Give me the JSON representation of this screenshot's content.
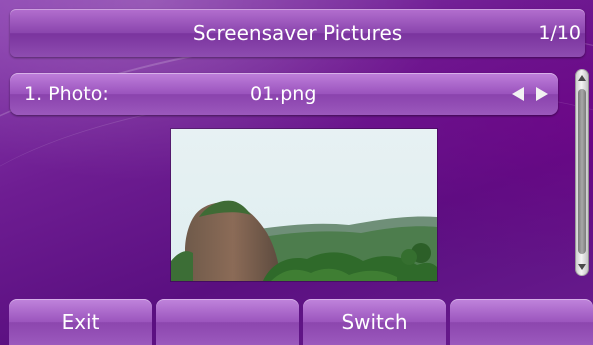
{
  "title_bar": {
    "title": "Screensaver Pictures",
    "page_indicator": "1/10"
  },
  "photo_row": {
    "label": "1. Photo:",
    "value": "01.png",
    "left_arrow_icon": "arrow-left-icon",
    "right_arrow_icon": "arrow-right-icon"
  },
  "preview": {
    "icon": "landscape-photo-thumbnail"
  },
  "scrollbar": {
    "up_icon": "scroll-up-icon",
    "down_icon": "scroll-down-icon"
  },
  "softkeys": [
    {
      "label": "Exit"
    },
    {
      "label": ""
    },
    {
      "label": "Switch"
    },
    {
      "label": ""
    }
  ],
  "colors": {
    "background": "#6e1d92",
    "text": "#ffffff"
  }
}
